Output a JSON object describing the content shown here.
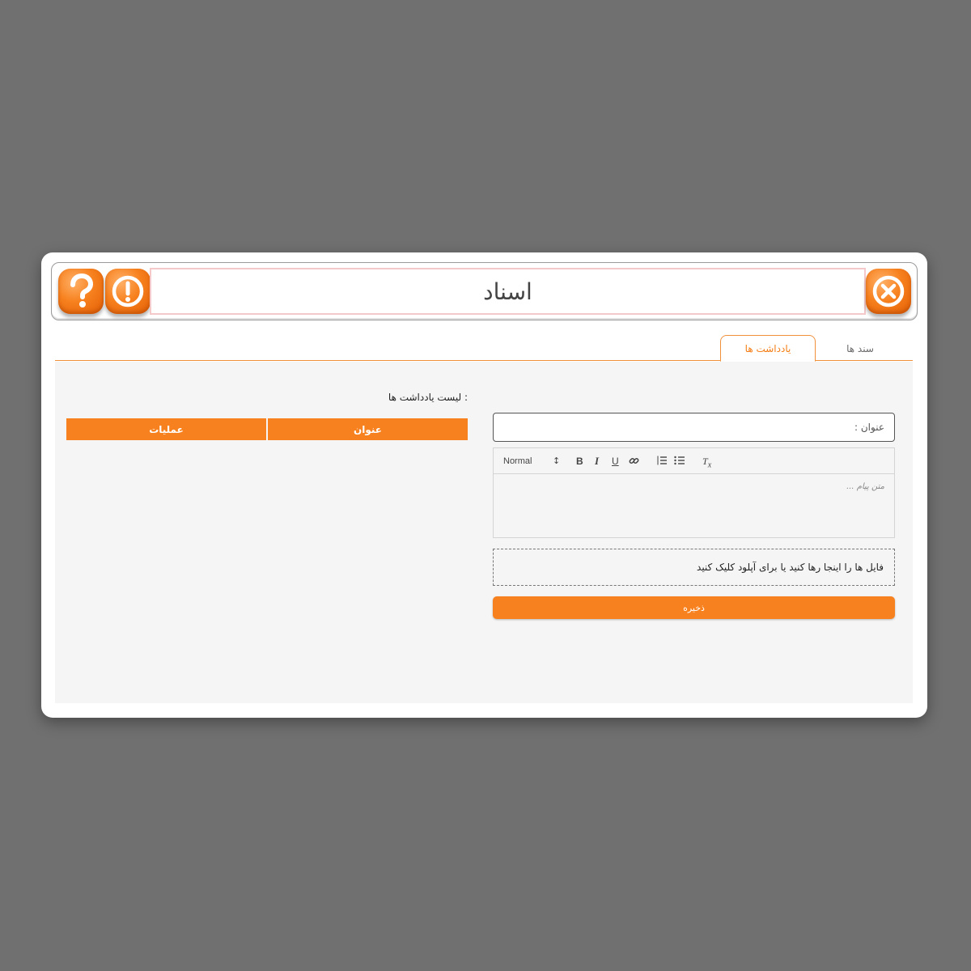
{
  "window": {
    "title": "اسناد"
  },
  "tabs": [
    {
      "label": "سند ها",
      "active": false
    },
    {
      "label": "یادداشت ها",
      "active": true
    }
  ],
  "notes_list": {
    "title": "لیست یادداشت ها :",
    "columns": [
      "عنوان",
      "عملیات"
    ],
    "rows": []
  },
  "form": {
    "title_placeholder": "عنوان :",
    "editor": {
      "format_select": "Normal",
      "placeholder": "متن پیام ..."
    },
    "dropzone_text": "فایل ها را اینجا رها کنید یا برای آپلود کلیک کنید",
    "save_label": "ذخیره"
  },
  "icons": {
    "help": "question-mark-icon",
    "info": "exclamation-icon",
    "close": "close-x-icon"
  },
  "colors": {
    "accent": "#f7811e",
    "background": "#707070",
    "panel": "#f5f5f5"
  }
}
